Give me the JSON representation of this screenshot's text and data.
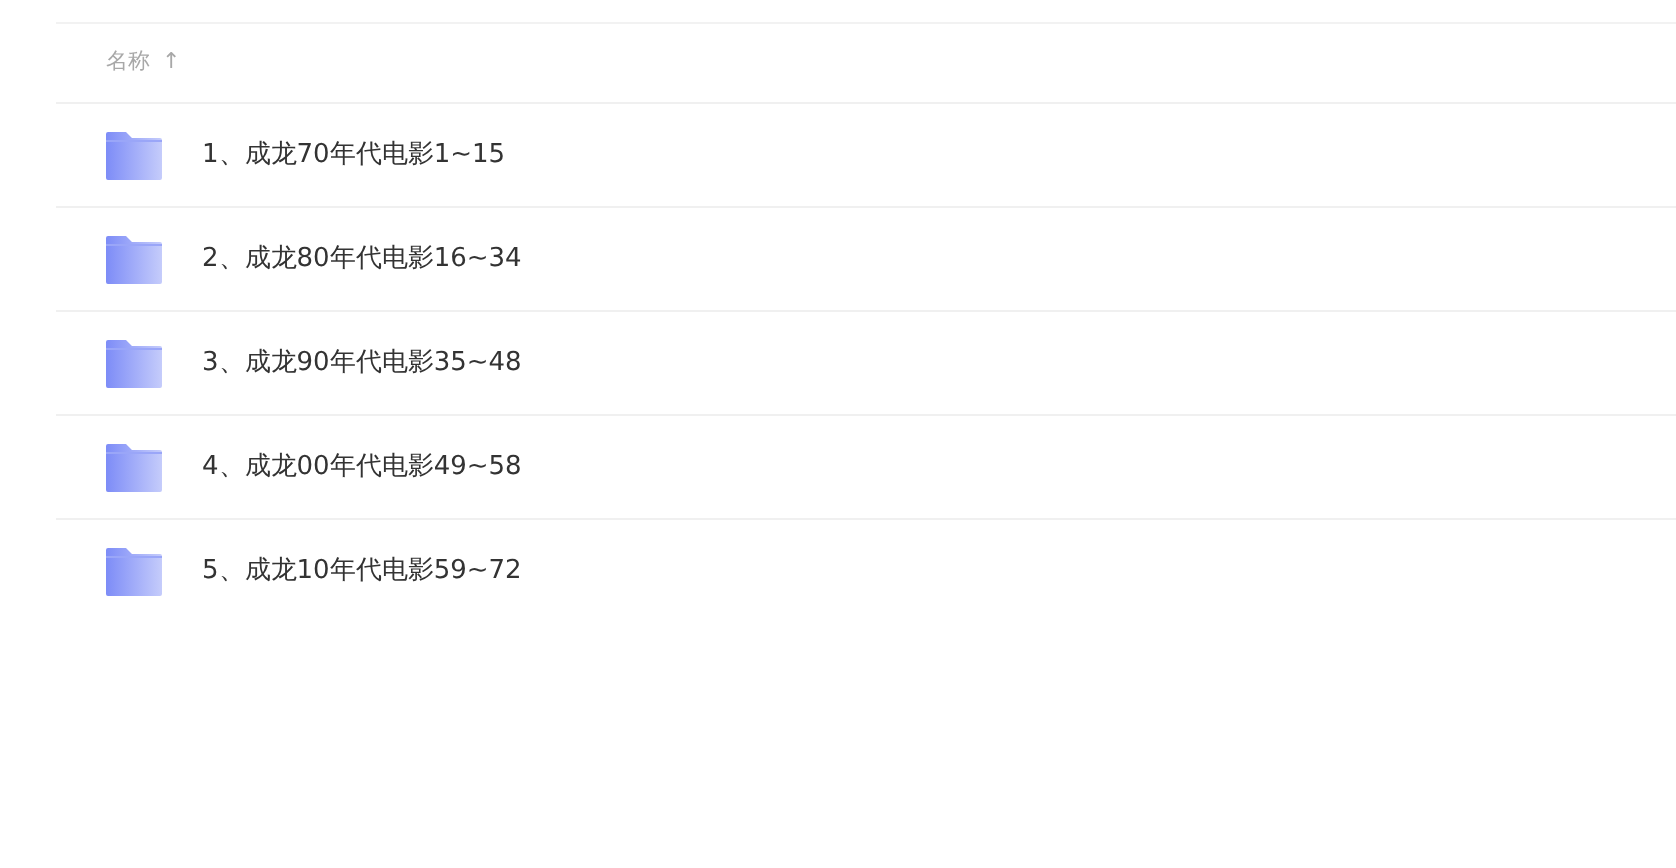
{
  "header": {
    "column": "名称",
    "sort_arrow": "↑"
  },
  "files": [
    {
      "name": "1、成龙70年代电影1~15"
    },
    {
      "name": "2、成龙80年代电影16~34"
    },
    {
      "name": "3、成龙90年代电影35~48"
    },
    {
      "name": "4、成龙00年代电影49~58"
    },
    {
      "name": "5、成龙10年代电影59~72"
    }
  ]
}
